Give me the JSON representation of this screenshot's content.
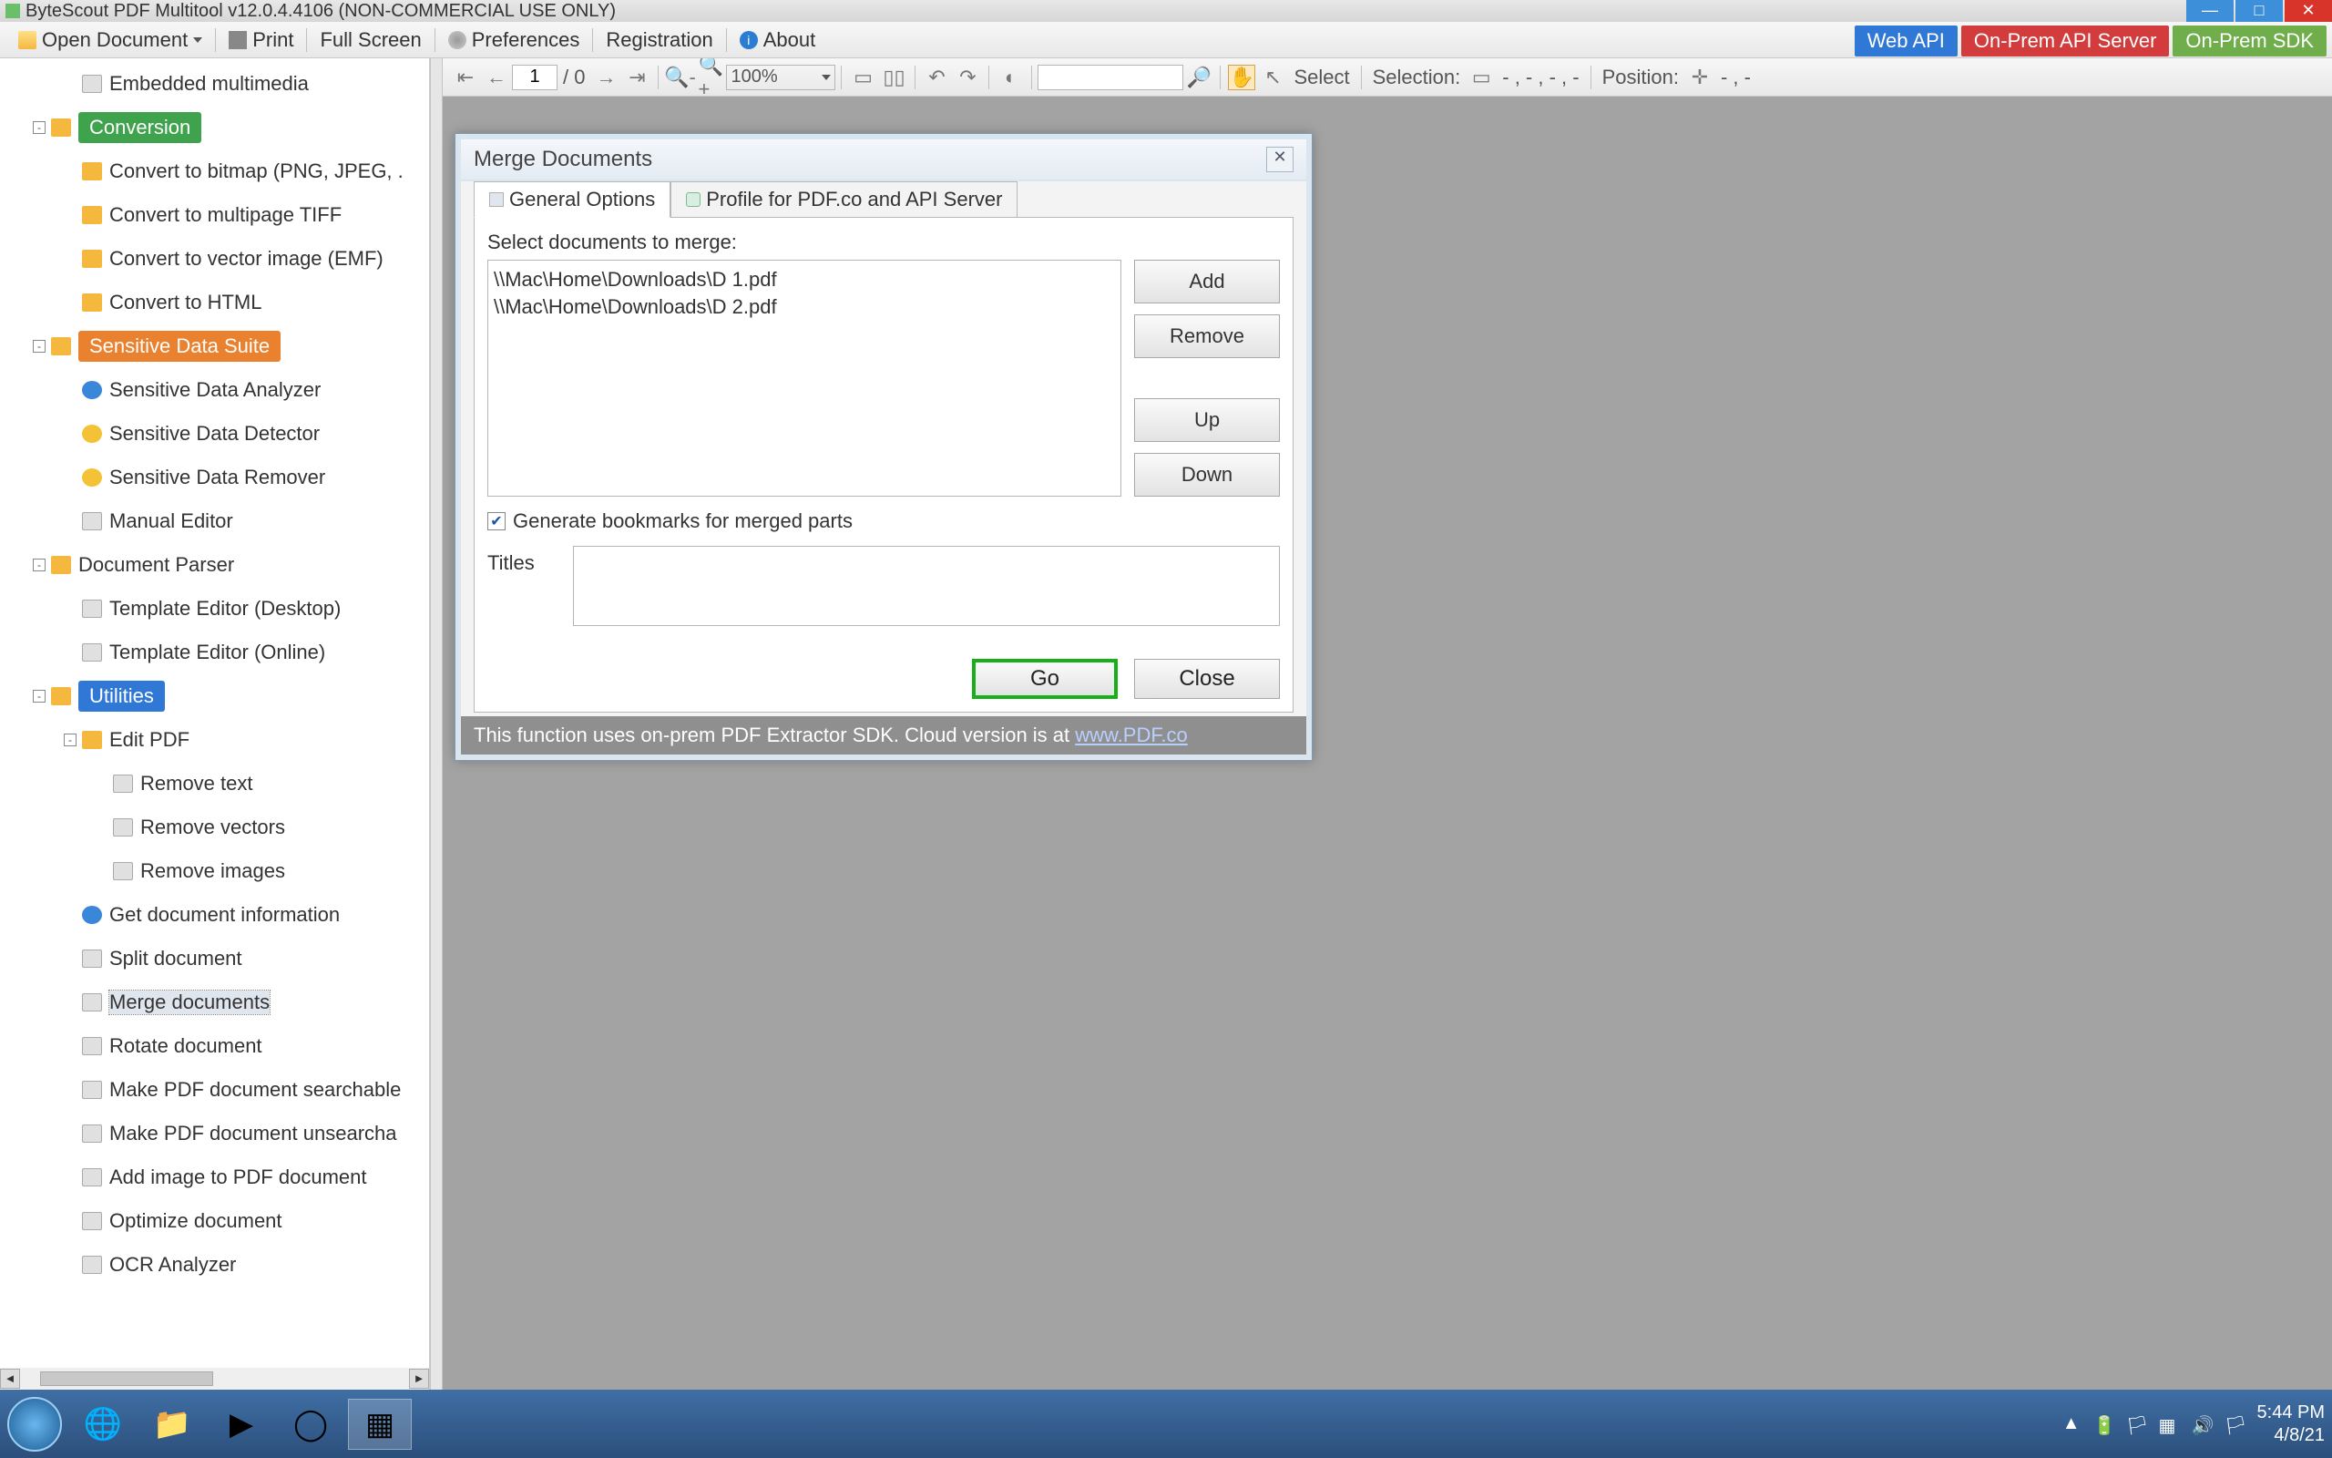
{
  "window": {
    "title": "ByteScout PDF Multitool v12.0.4.4106 (NON-COMMERCIAL USE ONLY)"
  },
  "toolbar": {
    "open_doc": "Open Document",
    "print": "Print",
    "full_screen": "Full Screen",
    "preferences": "Preferences",
    "registration": "Registration",
    "about": "About",
    "web_api": "Web API",
    "onprem_api": "On-Prem API Server",
    "onprem_sdk": "On-Prem SDK"
  },
  "doc_toolbar": {
    "page_current": "1",
    "page_total": "/ 0",
    "zoom": "100%",
    "select": "Select",
    "selection_label": "Selection:",
    "selection_value": "- , - , - , -",
    "position_label": "Position:",
    "position_value": "- , -"
  },
  "sidebar": {
    "items": [
      {
        "depth": 1,
        "icon": "doc",
        "label": "Embedded multimedia",
        "exp": ""
      },
      {
        "depth": 0,
        "icon": "",
        "label": "Conversion",
        "badge": "green",
        "exp": "-"
      },
      {
        "depth": 1,
        "icon": "folder",
        "label": "Convert to bitmap (PNG, JPEG, .",
        "exp": ""
      },
      {
        "depth": 1,
        "icon": "folder",
        "label": "Convert to multipage TIFF",
        "exp": ""
      },
      {
        "depth": 1,
        "icon": "folder",
        "label": "Convert to vector image (EMF)",
        "exp": ""
      },
      {
        "depth": 1,
        "icon": "folder",
        "label": "Convert to HTML",
        "exp": ""
      },
      {
        "depth": 0,
        "icon": "",
        "label": "Sensitive Data Suite",
        "badge": "orange",
        "exp": "-"
      },
      {
        "depth": 1,
        "icon": "info",
        "label": "Sensitive Data Analyzer",
        "exp": ""
      },
      {
        "depth": 1,
        "icon": "warn",
        "label": "Sensitive Data Detector",
        "exp": ""
      },
      {
        "depth": 1,
        "icon": "warn",
        "label": "Sensitive Data Remover",
        "exp": ""
      },
      {
        "depth": 1,
        "icon": "doc",
        "label": "Manual Editor",
        "exp": ""
      },
      {
        "depth": 0,
        "icon": "folder",
        "label": "Document Parser",
        "exp": "-"
      },
      {
        "depth": 1,
        "icon": "doc",
        "label": "Template Editor (Desktop)",
        "exp": ""
      },
      {
        "depth": 1,
        "icon": "doc",
        "label": "Template Editor (Online)",
        "exp": ""
      },
      {
        "depth": 0,
        "icon": "",
        "label": "Utilities",
        "badge": "blue",
        "exp": "-"
      },
      {
        "depth": 1,
        "icon": "folder",
        "label": "Edit PDF",
        "exp": "-"
      },
      {
        "depth": 2,
        "icon": "doc",
        "label": "Remove text",
        "exp": ""
      },
      {
        "depth": 2,
        "icon": "doc",
        "label": "Remove vectors",
        "exp": ""
      },
      {
        "depth": 2,
        "icon": "doc",
        "label": "Remove images",
        "exp": ""
      },
      {
        "depth": 1,
        "icon": "info",
        "label": "Get document information",
        "exp": ""
      },
      {
        "depth": 1,
        "icon": "doc",
        "label": "Split document",
        "exp": ""
      },
      {
        "depth": 1,
        "icon": "doc",
        "label": "Merge documents",
        "exp": "",
        "sel": true
      },
      {
        "depth": 1,
        "icon": "doc",
        "label": "Rotate document",
        "exp": ""
      },
      {
        "depth": 1,
        "icon": "doc",
        "label": "Make PDF document searchable",
        "exp": ""
      },
      {
        "depth": 1,
        "icon": "doc",
        "label": "Make PDF document unsearcha",
        "exp": ""
      },
      {
        "depth": 1,
        "icon": "doc",
        "label": "Add image to PDF document",
        "exp": ""
      },
      {
        "depth": 1,
        "icon": "doc",
        "label": "Optimize document",
        "exp": ""
      },
      {
        "depth": 1,
        "icon": "doc",
        "label": "OCR Analyzer",
        "exp": ""
      }
    ]
  },
  "dialog": {
    "title": "Merge Documents",
    "tab_general": "General Options",
    "tab_profile": "Profile for PDF.co and API Server",
    "select_label": "Select documents to merge:",
    "docs": [
      "\\\\Mac\\Home\\Downloads\\D 1.pdf",
      "\\\\Mac\\Home\\Downloads\\D 2.pdf"
    ],
    "btn_add": "Add",
    "btn_remove": "Remove",
    "btn_up": "Up",
    "btn_down": "Down",
    "chk_label": "Generate bookmarks for merged parts",
    "chk_checked": true,
    "titles_label": "Titles",
    "btn_go": "Go",
    "btn_close": "Close",
    "footer_text": "This function uses on-prem PDF Extractor SDK. Cloud version is at ",
    "footer_link": "www.PDF.co"
  },
  "taskbar": {
    "time": "5:44 PM",
    "date": "4/8/21"
  }
}
